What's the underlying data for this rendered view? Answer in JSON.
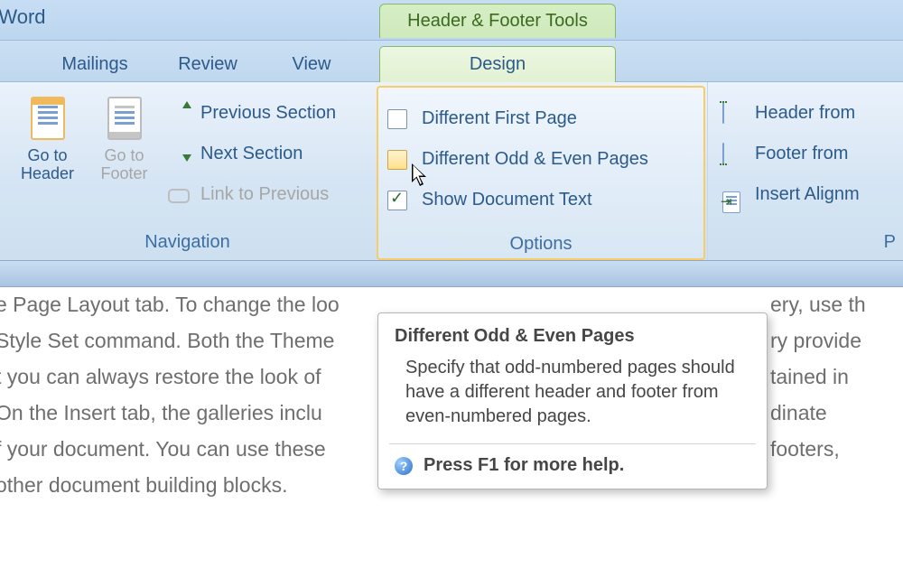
{
  "app": {
    "title_fragment": "ft Word"
  },
  "context_tab": {
    "label": "Header & Footer Tools"
  },
  "tabs": [
    "Mailings",
    "Review",
    "View",
    "Design"
  ],
  "ribbon": {
    "navigation": {
      "title": "Navigation",
      "go_header": [
        "Go to",
        "Header"
      ],
      "go_footer": [
        "Go to",
        "Footer"
      ],
      "prev": "Previous Section",
      "next": "Next Section",
      "link": "Link to Previous"
    },
    "options": {
      "title": "Options",
      "diff_first": "Different First Page",
      "diff_odd": "Different Odd & Even Pages",
      "show_doc": "Show Document Text",
      "checked": {
        "diff_first": false,
        "diff_odd": false,
        "show_doc": true
      },
      "hot": "diff_odd"
    },
    "position": {
      "title_char": "P",
      "header_from": "Header from",
      "footer_from": "Footer from",
      "insert_align": "Insert Alignm"
    }
  },
  "tooltip": {
    "title": "Different Odd & Even Pages",
    "body": "Specify that odd-numbered pages should have a different header and footer from even-numbered pages.",
    "footer": "Press F1 for more help."
  },
  "doc_lines": [
    "e Page Layout tab. To change the loo",
    "Style Set command. Both the Theme",
    "t you can always restore the look of",
    " On the Insert tab, the galleries inclu",
    "f your document. You can use these",
    "other document building blocks.",
    "ery, use th",
    "ry provide",
    "tained in",
    "dinate",
    "footers,"
  ]
}
